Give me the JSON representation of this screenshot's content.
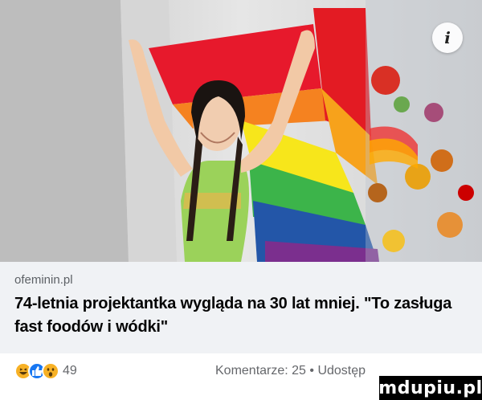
{
  "post": {
    "domain": "ofeminin.pl",
    "headline": "74-letnia projektantka wygląda na 30 lat mniej. \"To zasługa fast foodów i wódki\""
  },
  "image": {
    "info_icon": "i"
  },
  "footer": {
    "reaction_icons": [
      "haha-reaction-icon",
      "like-reaction-icon",
      "wow-reaction-icon"
    ],
    "reaction_count": "49",
    "comments_text": "Komentarze: 25 • Udostęp"
  },
  "watermark": "mdupiu.pl"
}
